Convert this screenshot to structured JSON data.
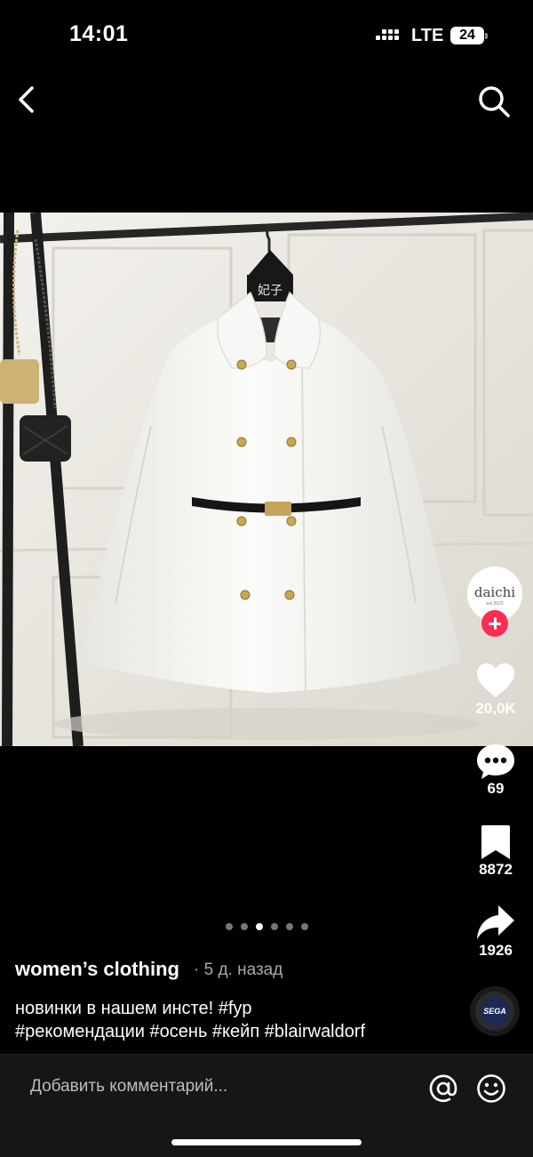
{
  "status_bar": {
    "time": "14:01",
    "network": "LTE",
    "battery": "24"
  },
  "nav": {
    "back_icon": "chevron-left-icon",
    "search_icon": "search-icon"
  },
  "media": {
    "hanger_label": "妃子",
    "slide_count": 6,
    "active_slide": 3
  },
  "creator": {
    "avatar_name": "daichi",
    "avatar_sub": "est 2023"
  },
  "actions": {
    "likes": "20,0K",
    "comments": "69",
    "saves": "8872",
    "shares": "1926"
  },
  "post": {
    "author": "women’s clothing",
    "time_ago": "· 5 д. назад",
    "caption_line1": "новинки в нашем инсте! #fyp",
    "caption_line2": "#рекомендации #осень #кейп #blairwaldorf"
  },
  "music": {
    "label": "SEGA"
  },
  "comment_bar": {
    "placeholder": "Добавить комментарий..."
  },
  "colors": {
    "accent": "#fe2c55",
    "background": "#000000",
    "secondary_text": "#a8a8a8"
  }
}
